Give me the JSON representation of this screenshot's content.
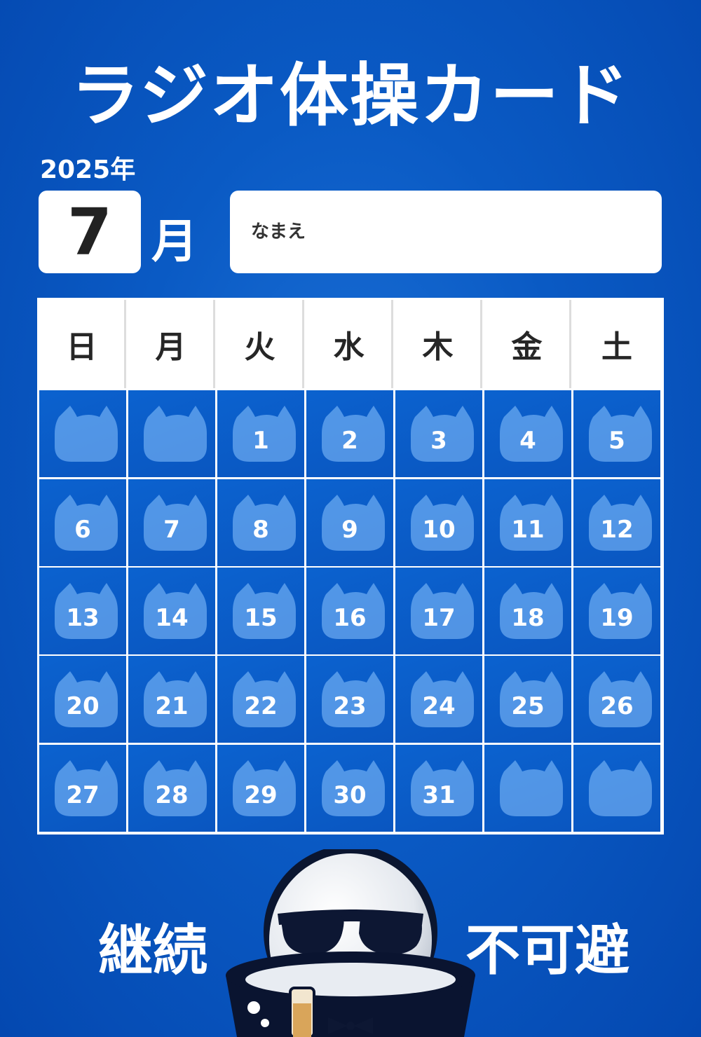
{
  "title": "ラジオ体操カード",
  "year_label": "2025年",
  "month_number": "7",
  "month_unit": "月",
  "name_label": "なまえ",
  "weekdays": [
    "日",
    "月",
    "火",
    "水",
    "木",
    "金",
    "土"
  ],
  "weeks": [
    [
      "",
      "",
      "1",
      "2",
      "3",
      "4",
      "5"
    ],
    [
      "6",
      "7",
      "8",
      "9",
      "10",
      "11",
      "12"
    ],
    [
      "13",
      "14",
      "15",
      "16",
      "17",
      "18",
      "19"
    ],
    [
      "20",
      "21",
      "22",
      "23",
      "24",
      "25",
      "26"
    ],
    [
      "27",
      "28",
      "29",
      "30",
      "31",
      "",
      ""
    ]
  ],
  "motto_left": "継続",
  "motto_right": "不可避",
  "icons": {
    "day_stamp": "cat-face-icon",
    "mascot": "egg-mascot-sunglasses"
  },
  "colors": {
    "background": "#0a5ac4",
    "cell": "#0a5ac4",
    "stamp": "#8cc4ff",
    "text_on_blue": "#ffffff",
    "card_white": "#ffffff"
  }
}
